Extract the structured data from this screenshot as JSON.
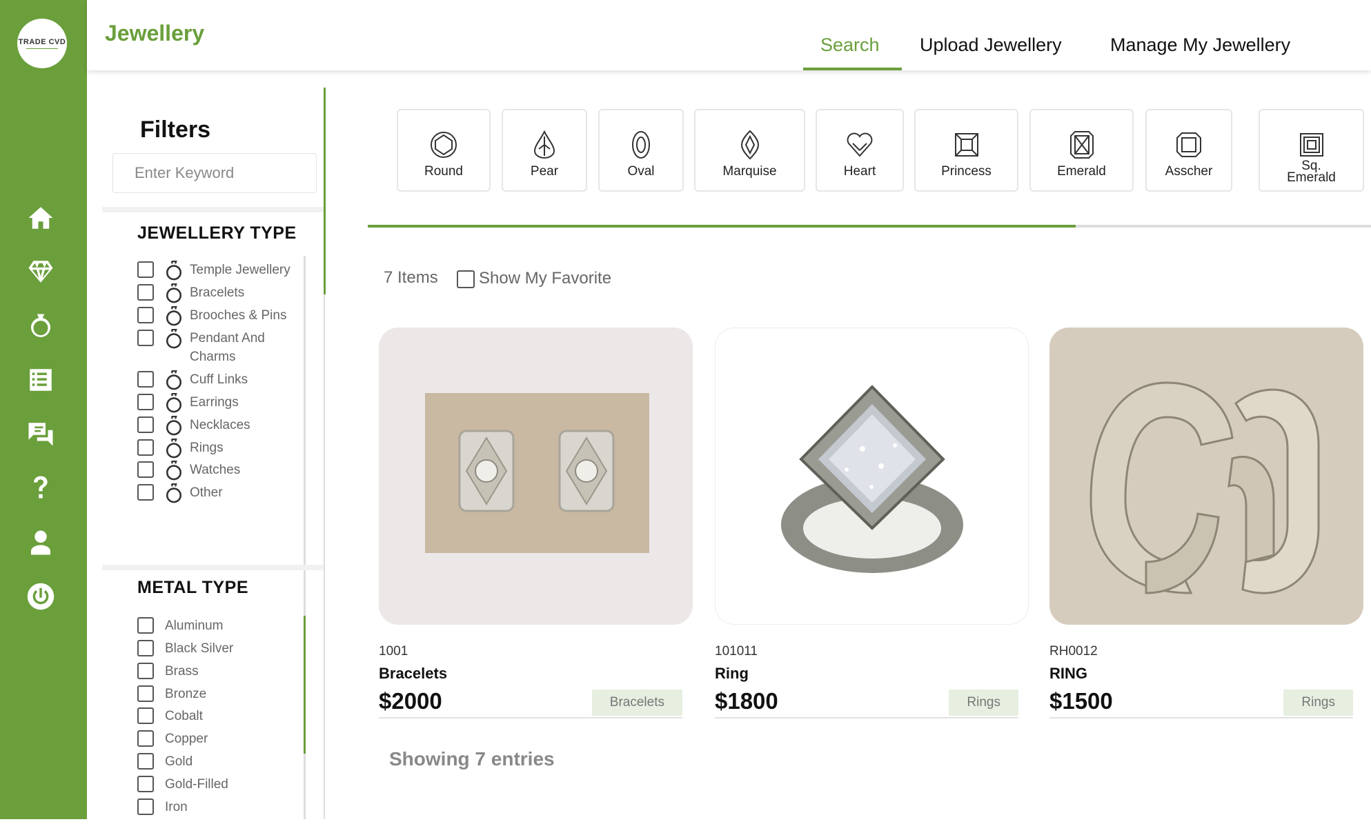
{
  "brand": {
    "logo_text": "TRADE CVD",
    "accent": "#6a9f3b"
  },
  "header": {
    "title": "Jewellery",
    "tabs": [
      {
        "label": "Search",
        "active": true
      },
      {
        "label": "Upload Jewellery",
        "active": false
      },
      {
        "label": "Manage My Jewellery",
        "active": false
      }
    ]
  },
  "sidebar": {
    "icons": [
      "home-icon",
      "diamond-icon",
      "ring-icon",
      "checklist-icon",
      "chat-icon",
      "help-icon",
      "user-icon",
      "power-icon"
    ]
  },
  "filters": {
    "title": "Filters",
    "keyword_placeholder": "Enter Keyword",
    "jewellery_type": {
      "title": "JEWELLERY TYPE",
      "options": [
        "Temple Jewellery",
        "Bracelets",
        "Brooches & Pins",
        "Pendant And Charms",
        "Cuff Links",
        "Earrings",
        "Necklaces",
        "Rings",
        "Watches",
        "Other"
      ]
    },
    "metal_type": {
      "title": "METAL TYPE",
      "options": [
        "Aluminum",
        "Black Silver",
        "Brass",
        "Bronze",
        "Cobalt",
        "Copper",
        "Gold",
        "Gold-Filled",
        "Iron"
      ]
    }
  },
  "shapes": [
    "Round",
    "Pear",
    "Oval",
    "Marquise",
    "Heart",
    "Princess",
    "Emerald",
    "Asscher",
    "Sq. Emerald"
  ],
  "results": {
    "count_label": "7 Items",
    "favorite_label": "Show My Favorite",
    "showing_label": "Showing 7 entries"
  },
  "cards": [
    {
      "id": "1001",
      "name": "Bracelets",
      "price": "$2000",
      "tag": "Bracelets"
    },
    {
      "id": "101011",
      "name": "Ring",
      "price": "$1800",
      "tag": "Rings"
    },
    {
      "id": "RH0012",
      "name": "RING",
      "price": "$1500",
      "tag": "Rings"
    }
  ]
}
